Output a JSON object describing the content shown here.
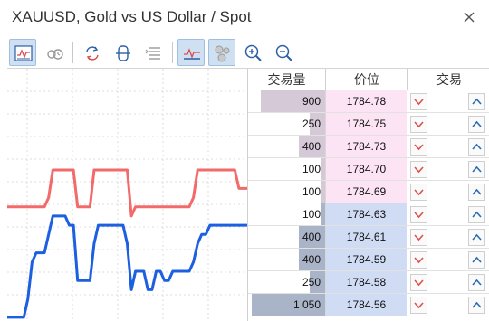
{
  "window": {
    "title": "XAUUSD, Gold vs US Dollar / Spot",
    "close_icon": "close-icon"
  },
  "toolbar": {
    "buttons": [
      {
        "icon": "chart-icon",
        "active": true
      },
      {
        "icon": "settings-icon",
        "active": false
      },
      {
        "icon": "trade-cycle-icon",
        "active": false
      },
      {
        "icon": "center-icon",
        "active": false
      },
      {
        "icon": "list-icon",
        "active": false
      },
      {
        "icon": "ticks-icon",
        "active": true
      },
      {
        "icon": "circles-icon",
        "active": true
      },
      {
        "icon": "zoom-in-icon",
        "active": false
      },
      {
        "icon": "zoom-out-icon",
        "active": false
      }
    ]
  },
  "depth": {
    "headers": {
      "volume": "交易量",
      "price": "价位",
      "trade": "交易"
    },
    "colors": {
      "ask_bg": "#fce4f5",
      "ask_bar": "#c7b6c9",
      "bid_bg": "#cfdcf4",
      "bid_bar": "#8e9bb6",
      "sell_arrow": "#d9534f",
      "buy_arrow": "#2a6db0"
    },
    "asks": [
      {
        "volume": "900",
        "price": "1784.78",
        "bar": 0.84
      },
      {
        "volume": "250",
        "price": "1784.75",
        "bar": 0.2
      },
      {
        "volume": "400",
        "price": "1784.73",
        "bar": 0.34
      },
      {
        "volume": "100",
        "price": "1784.70",
        "bar": 0.05
      },
      {
        "volume": "100",
        "price": "1784.69",
        "bar": 0.05
      }
    ],
    "bids": [
      {
        "volume": "100",
        "price": "1784.63",
        "bar": 0.05
      },
      {
        "volume": "400",
        "price": "1784.61",
        "bar": 0.34
      },
      {
        "volume": "400",
        "price": "1784.59",
        "bar": 0.34
      },
      {
        "volume": "250",
        "price": "1784.58",
        "bar": 0.2
      },
      {
        "volume": "1 050",
        "price": "1784.56",
        "bar": 0.95
      }
    ]
  },
  "chart_data": {
    "type": "line",
    "series": [
      {
        "color": "#f26a6a",
        "values": [
          1784.65,
          1784.65,
          1784.65,
          1784.65,
          1784.65,
          1784.65,
          1784.65,
          1784.65,
          1784.65,
          1784.65,
          1784.66,
          1784.69,
          1784.69,
          1784.69,
          1784.69,
          1784.69,
          1784.69,
          1784.65,
          1784.65,
          1784.65,
          1784.65,
          1784.69,
          1784.69,
          1784.69,
          1784.69,
          1784.69,
          1784.69,
          1784.69,
          1784.69,
          1784.69,
          1784.64,
          1784.65,
          1784.65,
          1784.65,
          1784.65,
          1784.65,
          1784.65,
          1784.65,
          1784.65,
          1784.65,
          1784.65,
          1784.65,
          1784.65,
          1784.65,
          1784.65,
          1784.66,
          1784.69,
          1784.69,
          1784.69,
          1784.69,
          1784.69,
          1784.69,
          1784.69,
          1784.69,
          1784.69,
          1784.69,
          1784.67,
          1784.67,
          1784.67
        ]
      },
      {
        "color": "#1c5fe0",
        "values": [
          1784.53,
          1784.53,
          1784.53,
          1784.53,
          1784.53,
          1784.55,
          1784.59,
          1784.6,
          1784.6,
          1784.6,
          1784.62,
          1784.64,
          1784.64,
          1784.64,
          1784.64,
          1784.63,
          1784.63,
          1784.57,
          1784.57,
          1784.57,
          1784.57,
          1784.61,
          1784.63,
          1784.63,
          1784.63,
          1784.63,
          1784.63,
          1784.63,
          1784.63,
          1784.61,
          1784.56,
          1784.58,
          1784.58,
          1784.58,
          1784.56,
          1784.56,
          1784.58,
          1784.58,
          1784.57,
          1784.57,
          1784.58,
          1784.58,
          1784.58,
          1784.58,
          1784.58,
          1784.59,
          1784.61,
          1784.62,
          1784.62,
          1784.63,
          1784.63,
          1784.63,
          1784.63,
          1784.63,
          1784.63,
          1784.63,
          1784.63,
          1784.63,
          1784.63
        ]
      }
    ],
    "ylim": [
      1784.525,
      1784.8
    ],
    "grid": true
  }
}
